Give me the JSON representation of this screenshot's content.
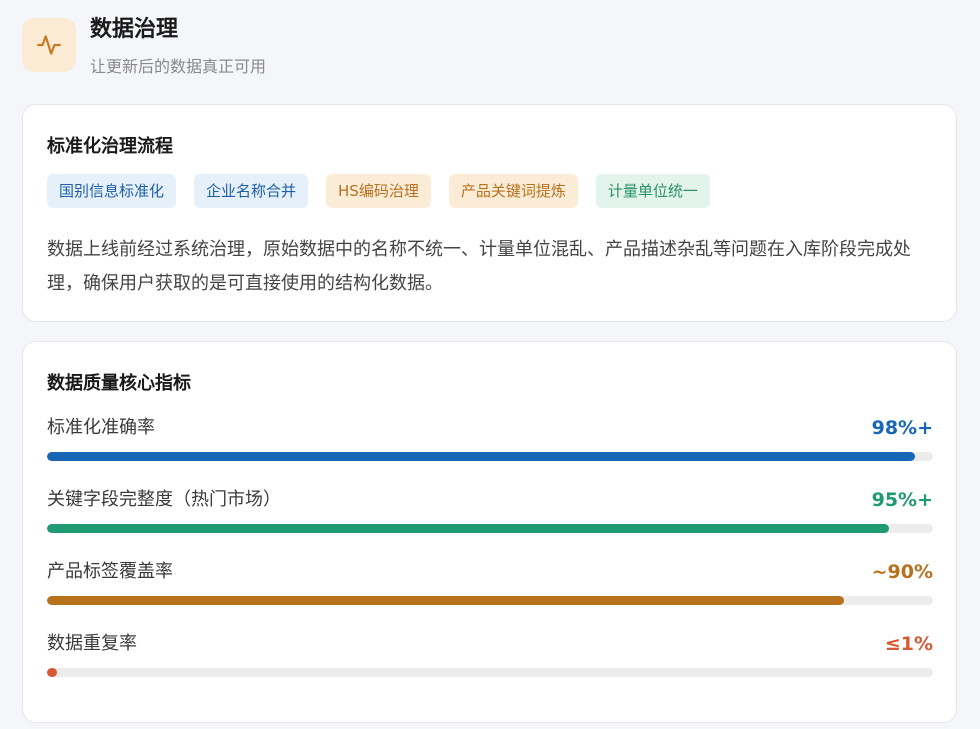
{
  "header": {
    "title": "数据治理",
    "subtitle": "让更新后的数据真正可用",
    "icon": "activity-pulse-icon"
  },
  "process": {
    "title": "标准化治理流程",
    "tags": [
      {
        "label": "国别信息标准化",
        "bg": "#e6f0fa",
        "fg": "#1f5fa8"
      },
      {
        "label": "企业名称合并",
        "bg": "#e6f0fa",
        "fg": "#1f5fa8"
      },
      {
        "label": "HS编码治理",
        "bg": "#fbecd8",
        "fg": "#b8711c"
      },
      {
        "label": "产品关键词提炼",
        "bg": "#fbecd8",
        "fg": "#b8711c"
      },
      {
        "label": "计量单位统一",
        "bg": "#e2f4ec",
        "fg": "#2a9266"
      }
    ],
    "description": "数据上线前经过系统治理，原始数据中的名称不统一、计量单位混乱、产品描述杂乱等问题在入库阶段完成处理，确保用户获取的是可直接使用的结构化数据。"
  },
  "quality": {
    "title": "数据质量核心指标",
    "metrics": [
      {
        "label": "标准化准确率",
        "value": "98%+",
        "progress": 0.98,
        "color": "#1767b5"
      },
      {
        "label": "关键字段完整度（热门市场）",
        "value": "95%+",
        "progress": 0.95,
        "color": "#1f9a72"
      },
      {
        "label": "产品标签覆盖率",
        "value": "~90%",
        "progress": 0.9,
        "color": "#b8711c"
      },
      {
        "label": "数据重复率",
        "value": "≤1%",
        "progress": 0.01,
        "color": "#d65a33"
      }
    ]
  }
}
